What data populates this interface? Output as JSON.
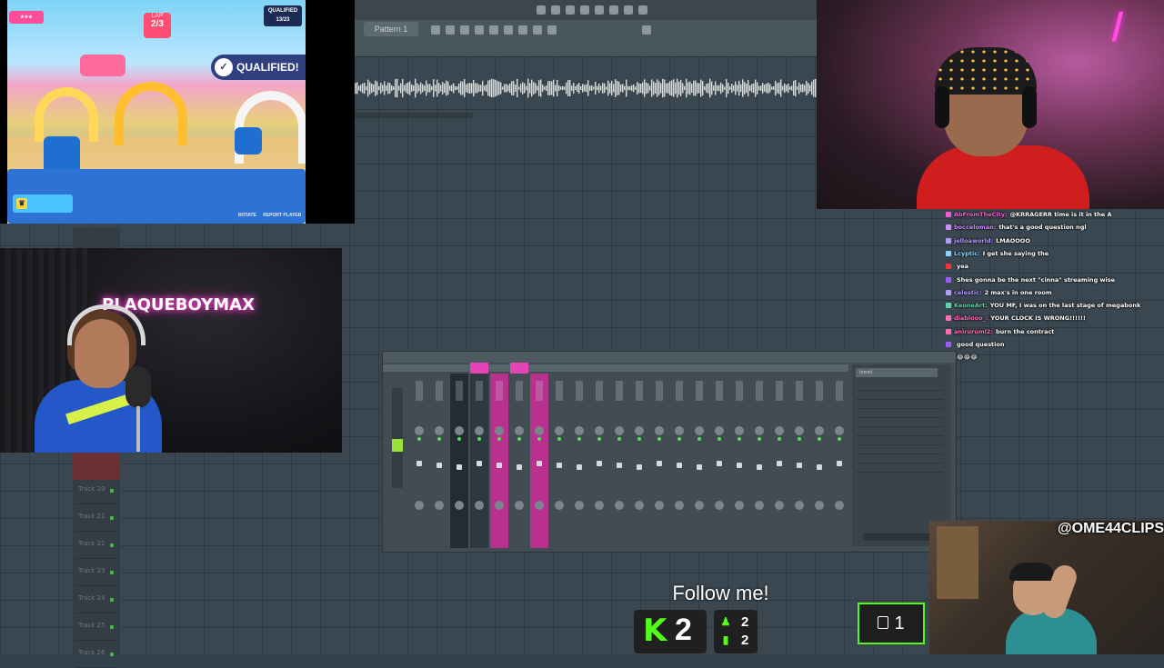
{
  "game": {
    "lap_label": "LAP",
    "lap_value": "2/3",
    "qualified_count_label": "QUALIFIED",
    "qualified_count": "13/23",
    "qualified_banner": "QUALIFIED!",
    "hint_rotate": "ROTATE",
    "hint_report": "REPORT PLAYER"
  },
  "daw": {
    "pattern_label": "Pattern 1",
    "tracks": [
      "Track 20",
      "Track 21",
      "Track 22",
      "Track 23",
      "Track 24",
      "Track 25",
      "Track 26"
    ]
  },
  "cam_girl": {
    "neon_text": "PLAQUEBOYMAX"
  },
  "chat": {
    "messages": [
      {
        "user": "AbFromTheCity",
        "text": "@KRRAGERR time is it in the A",
        "color": "#ff5ad7"
      },
      {
        "user": "bocceloman",
        "text": "that's a good question ngl",
        "color": "#d38cff"
      },
      {
        "user": "jelloaworld",
        "text": "LMAOOOO",
        "color": "#b29bff"
      },
      {
        "user": "Lcyptic",
        "text": "I get she saying the",
        "color": "#8fd3ff"
      },
      {
        "user": "",
        "text": "yea",
        "color": "#ff3333"
      },
      {
        "user": "",
        "text": "Shes gonna be the next \"cinna\" streaming wise",
        "color": "#9b59ff"
      },
      {
        "user": "celestic",
        "text": "2 max's in one room",
        "color": "#b29bff"
      },
      {
        "user": "KeoneArt",
        "text": "YOU MF, I was on the last stage of megabonk",
        "color": "#5ad7a4"
      },
      {
        "user": "diablooo_",
        "text": "YOUR CLOCK IS WRONG!!!!!!",
        "color": "#ff6db7"
      },
      {
        "user": "aniruruml2",
        "text": "burn the contract",
        "color": "#ff6db7"
      },
      {
        "user": "",
        "text": "good question",
        "color": "#9b59ff"
      },
      {
        "user": "",
        "text": "😂😂😂",
        "color": "#5a7dff"
      }
    ]
  },
  "overlay": {
    "follow_text": "Follow me!",
    "kick_count": "2",
    "stat_1": "2",
    "stat_2": "2",
    "handle": "@OME44CLIPS",
    "viewer_count": "1"
  },
  "colors": {
    "kick_green": "#53fc18",
    "mixer_pink": "#b8318f"
  }
}
